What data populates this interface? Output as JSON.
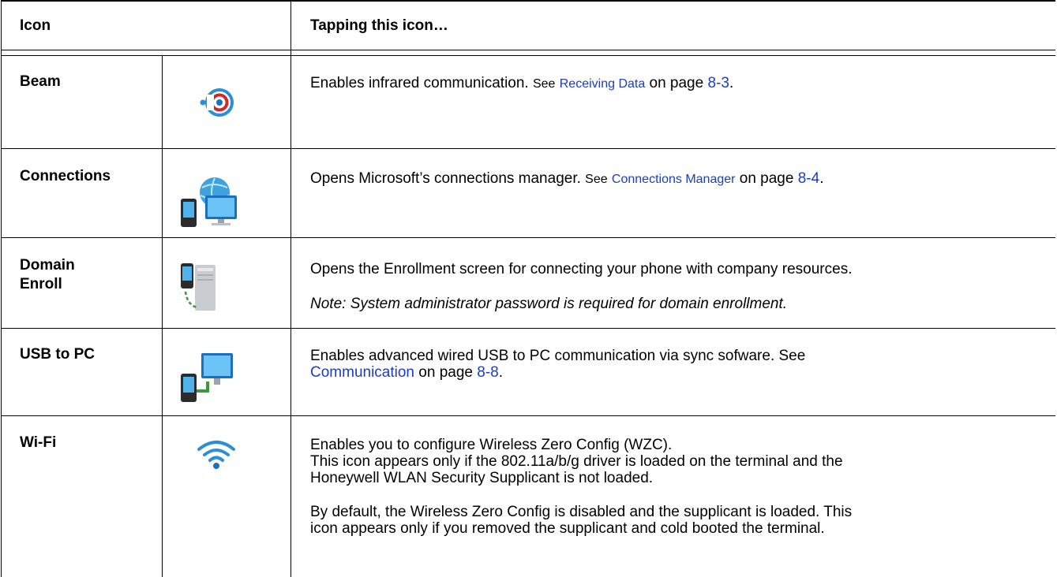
{
  "header": {
    "icon_col": "Icon",
    "desc_col": "Tapping this icon…"
  },
  "rows": [
    {
      "name": "Beam",
      "icon": "beam-icon",
      "desc": "Enables infrared communication.",
      "see": "See",
      "link": "Receiving Data",
      "on_page": "on page",
      "page": "8-3",
      "end": "."
    },
    {
      "name": "Connections",
      "icon": "connections-icon",
      "desc": "Opens Microsoft’s connections manager.",
      "see": "See",
      "link": "Connections Manager",
      "on_page": "on page",
      "page": "8-4",
      "end": "."
    },
    {
      "name_line1": "Domain",
      "name_line2": "Enroll",
      "icon": "domain-enroll-icon",
      "desc": "Opens the Enrollment screen for connecting your phone with company resources.",
      "note": "Note: System administrator password is required for domain enrollment."
    },
    {
      "name": "USB to PC",
      "icon": "usb-to-pc-icon",
      "desc": "Enables advanced wired USB to PC communication via sync sofware. See",
      "link": "Communication",
      "on_page": "on page",
      "page": "8-8",
      "end": "."
    },
    {
      "name": "Wi-Fi",
      "icon": "wifi-icon",
      "desc_line1": "Enables you to configure Wireless Zero Config (WZC).",
      "desc_line2": "This icon appears only if the 802.11a/b/g driver is loaded on the terminal and the",
      "desc_line3": "Honeywell WLAN Security Supplicant is not loaded.",
      "desc_line4": "By default, the Wireless Zero Config is disabled and the supplicant is loaded. This",
      "desc_line5": "icon appears only if you removed the supplicant and cold booted the terminal."
    }
  ],
  "colors": {
    "link": "#1a3cc8",
    "rule": "#000000"
  }
}
